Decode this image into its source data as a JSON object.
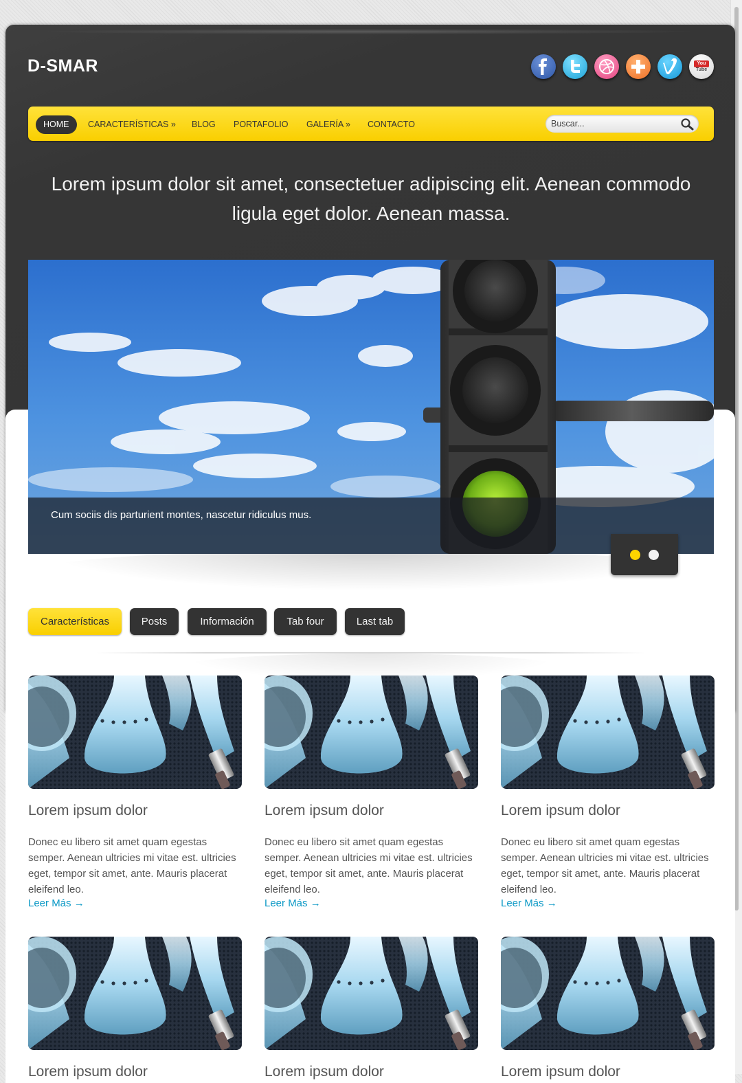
{
  "header": {
    "logo": "D-SMAR",
    "social_icons": [
      "facebook-icon",
      "twitter-icon",
      "dribbble-icon",
      "google-plus-icon",
      "vimeo-icon",
      "youtube-icon"
    ],
    "youtube_label": "You Tube"
  },
  "nav": {
    "items": [
      "HOME",
      "CARACTERÍSTICAS »",
      "BLOG",
      "PORTAFOLIO",
      "GALERÍA »",
      "CONTACTO"
    ],
    "search_placeholder": "Buscar..."
  },
  "tagline": "Lorem ipsum dolor sit amet, consectetuer adipiscing elit. Aenean commodo ligula eget dolor. Aenean massa.",
  "slider": {
    "caption": "Cum sociis dis parturient montes, nascetur ridiculus mus.",
    "active_slide": 1,
    "slide_count": 2
  },
  "tabs": [
    "Características",
    "Posts",
    "Información",
    "Tab four",
    "Last tab"
  ],
  "posts": [
    {
      "title": "Lorem ipsum dolor",
      "excerpt": "Donec eu libero sit amet quam egestas semper. Aenean ultricies mi vitae est. ultricies eget, tempor sit amet, ante. Mauris placerat eleifend leo.",
      "link": "Leer Más →"
    },
    {
      "title": "Lorem ipsum dolor",
      "excerpt": "Donec eu libero sit amet quam egestas semper. Aenean ultricies mi vitae est. ultricies eget, tempor sit amet, ante. Mauris placerat eleifend leo.",
      "link": "Leer Más →"
    },
    {
      "title": "Lorem ipsum dolor",
      "excerpt": "Donec eu libero sit amet quam egestas semper. Aenean ultricies mi vitae est. ultricies eget, tempor sit amet, ante. Mauris placerat eleifend leo.",
      "link": "Leer Más →"
    },
    {
      "title": "Lorem ipsum dolor"
    },
    {
      "title": "Lorem ipsum dolor"
    },
    {
      "title": "Lorem ipsum dolor"
    }
  ],
  "colors": {
    "accent_yellow": "#fcd500",
    "dark": "#333333",
    "link": "#0a98c5"
  }
}
